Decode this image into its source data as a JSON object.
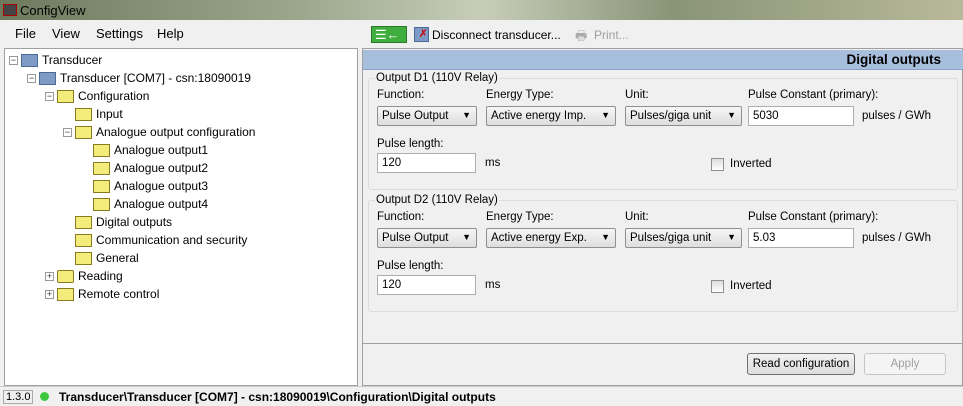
{
  "window": {
    "title": "ConfigView"
  },
  "menu": [
    "File",
    "View",
    "Settings",
    "Help"
  ],
  "toolbar": {
    "disconnect_label": "Disconnect transducer...",
    "print_label": "Print..."
  },
  "tree": [
    {
      "label": "Transducer",
      "level": 0,
      "icon": "device-icon",
      "expander": "minus"
    },
    {
      "label": "Transducer [COM7] - csn:18090019",
      "level": 1,
      "icon": "device-icon",
      "expander": "minus"
    },
    {
      "label": "Configuration",
      "level": 2,
      "icon": "folder-edit-icon",
      "expander": "minus"
    },
    {
      "label": "Input",
      "level": 3,
      "icon": "folder-edit-icon",
      "expander": ""
    },
    {
      "label": "Analogue output configuration",
      "level": 3,
      "icon": "folder-icon",
      "expander": "minus"
    },
    {
      "label": "Analogue output1",
      "level": 4,
      "icon": "folder-edit-icon",
      "expander": ""
    },
    {
      "label": "Analogue output2",
      "level": 4,
      "icon": "folder-edit-icon",
      "expander": ""
    },
    {
      "label": "Analogue output3",
      "level": 4,
      "icon": "folder-edit-icon",
      "expander": ""
    },
    {
      "label": "Analogue output4",
      "level": 4,
      "icon": "folder-edit-icon",
      "expander": ""
    },
    {
      "label": "Digital outputs",
      "level": 3,
      "icon": "folder-edit-icon",
      "expander": ""
    },
    {
      "label": "Communication and security",
      "level": 3,
      "icon": "folder-edit-icon",
      "expander": ""
    },
    {
      "label": "General",
      "level": 3,
      "icon": "folder-edit-icon",
      "expander": ""
    },
    {
      "label": "Reading",
      "level": 2,
      "icon": "reading-icon",
      "expander": "plus"
    },
    {
      "label": "Remote control",
      "level": 2,
      "icon": "folder-icon",
      "expander": "plus"
    }
  ],
  "panel": {
    "title": "Digital outputs",
    "labels": {
      "function": "Function:",
      "energy_type": "Energy Type:",
      "unit": "Unit:",
      "pulse_constant": "Pulse Constant (primary):",
      "pulse_length": "Pulse length:",
      "ms": "ms",
      "inverted": "Inverted"
    },
    "outputs": [
      {
        "title": "Output D1 (110V Relay)",
        "function": "Pulse Output",
        "energy_type": "Active energy Imp.",
        "unit": "Pulses/giga unit",
        "pulse_constant": "5030",
        "pulse_constant_unit": "pulses / GWh",
        "pulse_length": "120",
        "inverted": false
      },
      {
        "title": "Output D2 (110V Relay)",
        "function": "Pulse Output",
        "energy_type": "Active energy Exp.",
        "unit": "Pulses/giga unit",
        "pulse_constant": "5.03",
        "pulse_constant_unit": "pulses / GWh",
        "pulse_length": "120",
        "inverted": false
      }
    ],
    "read_label": "Read configuration",
    "apply_label": "Apply"
  },
  "status": {
    "version": "1.3.0",
    "path": "Transducer\\Transducer [COM7] - csn:18090019\\Configuration\\Digital outputs",
    "connection_color": "#3cc83c"
  }
}
